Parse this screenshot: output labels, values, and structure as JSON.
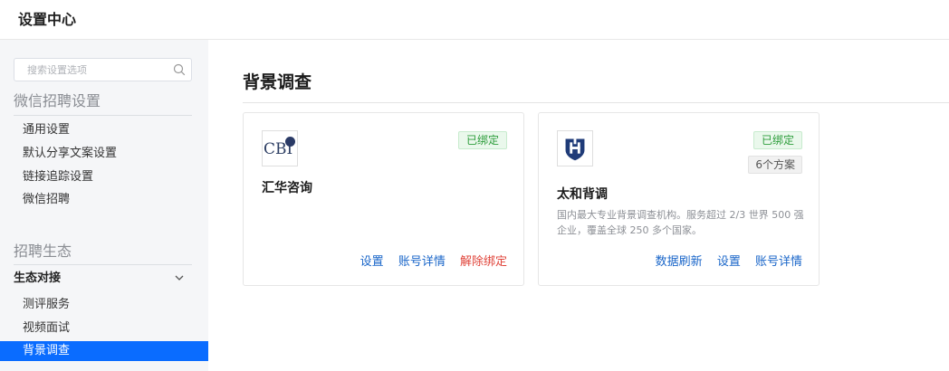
{
  "app": {
    "title": "设置中心"
  },
  "sidebar": {
    "search_placeholder": "搜索设置选项",
    "section1": {
      "title": "微信招聘设置",
      "items": [
        {
          "label": "通用设置"
        },
        {
          "label": "默认分享文案设置"
        },
        {
          "label": "链接追踪设置"
        },
        {
          "label": "微信招聘"
        }
      ]
    },
    "section2": {
      "title": "招聘生态",
      "group": {
        "label": "生态对接",
        "items": [
          {
            "label": "测评服务"
          },
          {
            "label": "视频面试"
          },
          {
            "label": "背景调查",
            "active": true
          }
        ]
      }
    }
  },
  "main": {
    "title": "背景调查",
    "cards": [
      {
        "name": "汇华咨询",
        "logo_text": "CBI",
        "status": "已绑定",
        "actions": [
          "设置",
          "账号详情",
          "解除绑定"
        ]
      },
      {
        "name": "太和背调",
        "status": "已绑定",
        "plans": "6个方案",
        "description": "国内最大专业背景调查机构。服务超过 2/3 世界 500 强企业，覆盖全球 250 多个国家。",
        "actions": [
          "数据刷新",
          "设置",
          "账号详情"
        ]
      }
    ]
  },
  "colors": {
    "accent": "#0a6cff",
    "bound": "#2d9d3b",
    "link": "#1a66c9",
    "danger": "#e0443a"
  }
}
